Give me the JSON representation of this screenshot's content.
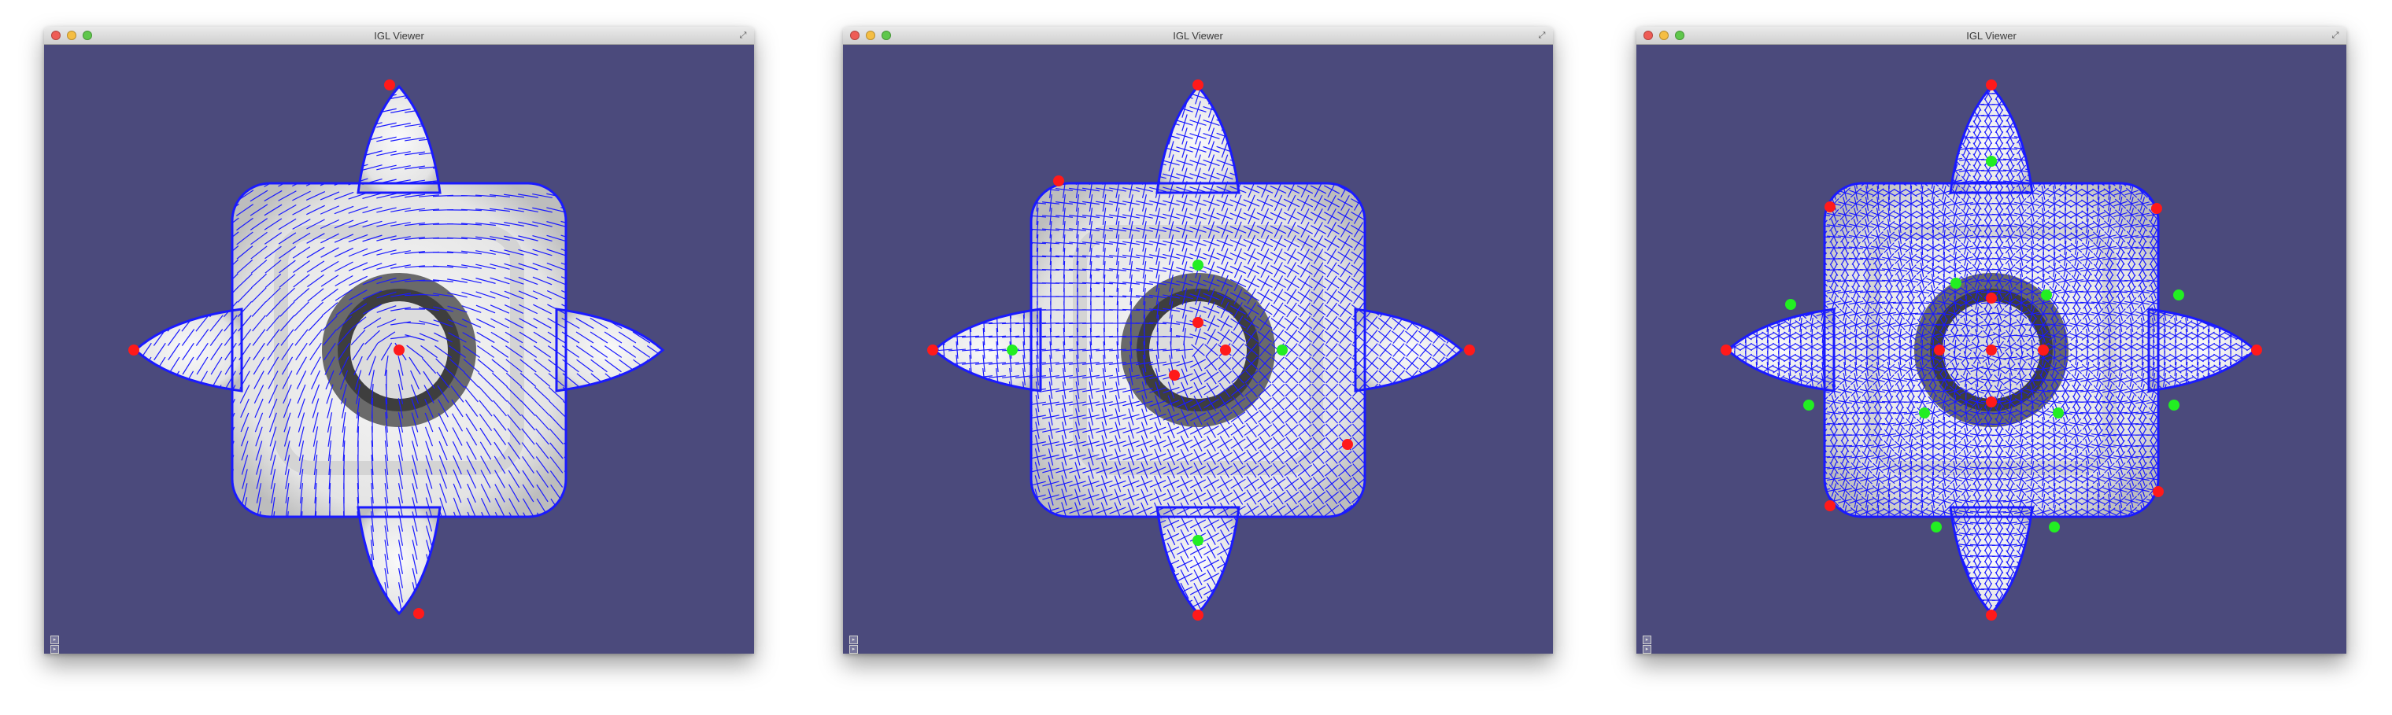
{
  "windows": [
    {
      "title": "IGL Viewer",
      "mode": "direction-field"
    },
    {
      "title": "IGL Viewer",
      "mode": "cross-field"
    },
    {
      "title": "IGL Viewer",
      "mode": "dense-field"
    }
  ],
  "colors": {
    "background": "#4b4a7c",
    "mesh_surface": "#ededed",
    "field_lines": "#1a1aff",
    "singularity_negative": "#ff1a1a",
    "singularity_positive": "#22ee22"
  },
  "icons": [
    "close-icon",
    "minimize-icon",
    "zoom-icon",
    "fullscreen-icon",
    "viewer-menu-icon"
  ]
}
